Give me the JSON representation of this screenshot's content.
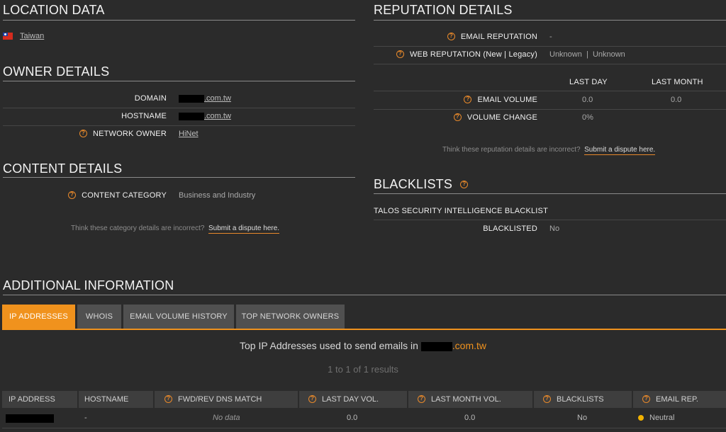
{
  "location": {
    "title": "LOCATION DATA",
    "country": "Taiwan"
  },
  "owner": {
    "title": "OWNER DETAILS",
    "domain_label": "DOMAIN",
    "domain_suffix": ".com.tw",
    "hostname_label": "HOSTNAME",
    "hostname_suffix": ".com.tw",
    "network_owner_label": "NETWORK OWNER",
    "network_owner_value": "HiNet"
  },
  "content": {
    "title": "CONTENT DETAILS",
    "category_label": "CONTENT CATEGORY",
    "category_value": "Business and Industry",
    "dispute_prompt": "Think these category details are incorrect?",
    "dispute_link": "Submit a dispute here."
  },
  "reputation": {
    "title": "REPUTATION DETAILS",
    "email_rep_label": "EMAIL REPUTATION",
    "email_rep_value": "-",
    "web_rep_label_main": "WEB REPUTATION",
    "web_rep_label_sub": "(New | Legacy)",
    "web_rep_value": "Unknown  |  Unknown",
    "col_last_day": "LAST DAY",
    "col_last_month": "LAST MONTH",
    "email_volume_label": "EMAIL VOLUME",
    "email_volume_day": "0.0",
    "email_volume_month": "0.0",
    "volume_change_label": "VOLUME CHANGE",
    "volume_change_day": "0%",
    "dispute_prompt": "Think these reputation details are incorrect?",
    "dispute_link": "Submit a dispute here."
  },
  "blacklists": {
    "title": "BLACKLISTS",
    "source": "TALOS SECURITY INTELLIGENCE BLACKLIST",
    "blacklisted_label": "BLACKLISTED",
    "blacklisted_value": "No"
  },
  "additional": {
    "title": "ADDITIONAL INFORMATION",
    "tabs": [
      "IP ADDRESSES",
      "WHOIS",
      "EMAIL VOLUME HISTORY",
      "TOP NETWORK OWNERS"
    ],
    "heading_prefix": "Top IP Addresses used to send emails in",
    "heading_domain_suffix": ".com.tw",
    "results": "1 to 1 of 1 results",
    "columns": [
      "IP ADDRESS",
      "HOSTNAME",
      "FWD/REV DNS MATCH",
      "LAST DAY VOL.",
      "LAST MONTH VOL.",
      "BLACKLISTS",
      "EMAIL REP."
    ],
    "row": {
      "hostname": "-",
      "dns_match": "No data",
      "last_day_vol": "0.0",
      "last_month_vol": "0.0",
      "blacklists": "No",
      "email_rep": "Neutral"
    }
  },
  "colors": {
    "accent": "#f0921d",
    "background": "#2b2b2b",
    "neutral_dot": "#f2b200"
  }
}
